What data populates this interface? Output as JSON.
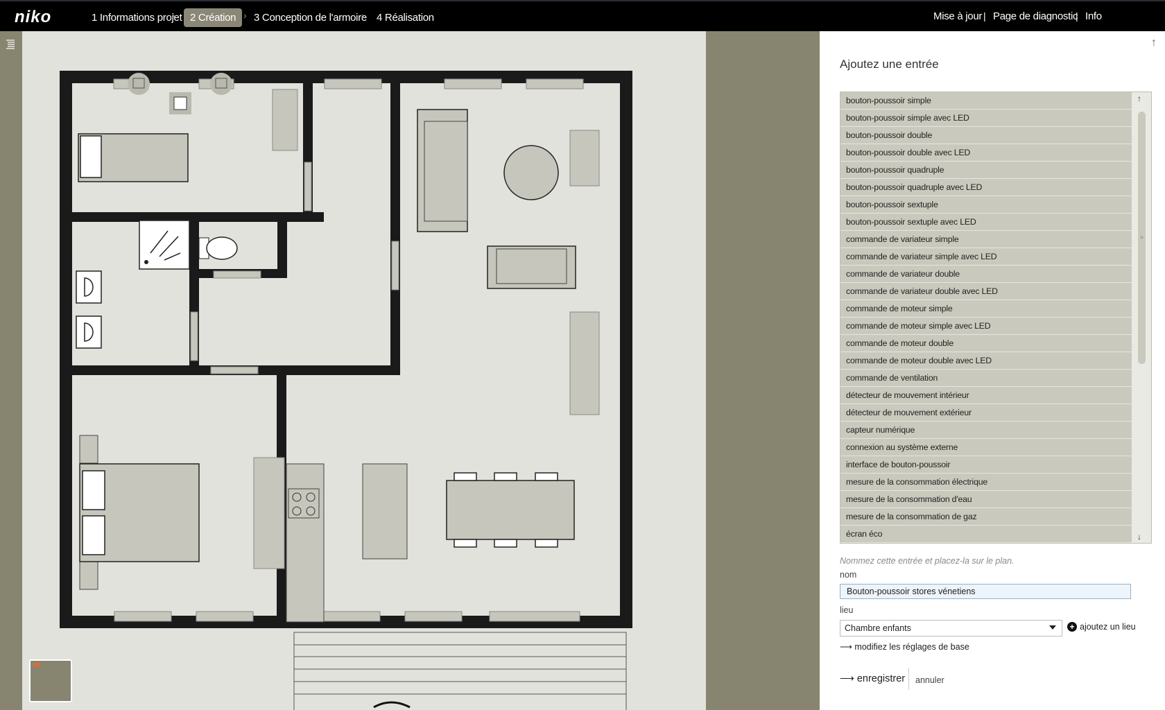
{
  "header": {
    "logo": "niko",
    "steps": [
      {
        "label": "1 Informations projet"
      },
      {
        "label": "2 Création"
      },
      {
        "label": "3 Conception de l'armoire"
      },
      {
        "label": "4 Réalisation"
      }
    ],
    "links": {
      "update": "Mise à jour",
      "diagnostic": "Page de diagnostic",
      "info": "Info"
    },
    "separator": "|"
  },
  "icons": {
    "menu": "list-menu-icon",
    "scroll_top": "arrow-up-icon",
    "chevron": "chevron-right-icon"
  },
  "panel": {
    "title": "Ajoutez une entrée",
    "items": [
      "bouton-poussoir simple",
      "bouton-poussoir simple avec LED",
      "bouton-poussoir double",
      "bouton-poussoir double avec LED",
      "bouton-poussoir quadruple",
      "bouton-poussoir quadruple avec LED",
      "bouton-poussoir sextuple",
      "bouton-poussoir sextuple avec LED",
      "commande de variateur simple",
      "commande de variateur simple avec LED",
      "commande de variateur double",
      "commande de variateur double avec LED",
      "commande de moteur simple",
      "commande de moteur simple avec LED",
      "commande de moteur double",
      "commande de moteur double avec LED",
      "commande de ventilation",
      "détecteur de mouvement intérieur",
      "détecteur de mouvement extérieur",
      "capteur numérique",
      "connexion au système externe",
      "interface de bouton-poussoir",
      "mesure de la consommation électrique",
      "mesure de la consommation d'eau",
      "mesure de la consommation de gaz",
      "écran éco"
    ],
    "hint": "Nommez cette entrée et placez-la sur le plan.",
    "name_label": "nom",
    "name_value": "Bouton-poussoir stores vénetiens",
    "place_label": "lieu",
    "place_value": "Chambre enfants",
    "add_place": "ajoutez un lieu",
    "base_settings": "modifiez les réglages de base",
    "save": "enregistrer",
    "cancel": "annuler"
  },
  "colors": {
    "accent": "#8a8777",
    "topbar": "#000000",
    "list_item": "#c9c9bd",
    "wall": "#1a1a1a",
    "floor": "#e2e2dc"
  }
}
